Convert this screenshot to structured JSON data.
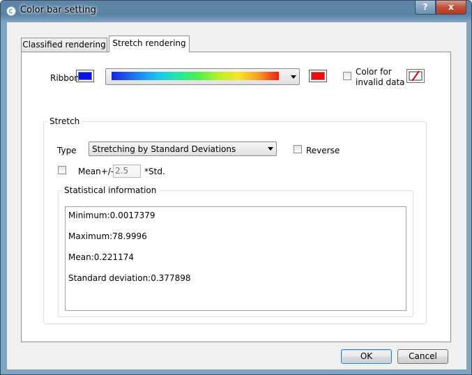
{
  "window": {
    "title": "Color bar setting",
    "help_label": "?",
    "close_label": "x"
  },
  "tabs": [
    {
      "label": "Classified rendering",
      "active": false
    },
    {
      "label": "Stretch rendering",
      "active": true
    }
  ],
  "ribbon": {
    "label": "Ribbon",
    "start_color": "#0a14e6",
    "end_color": "#ee0c0c",
    "invalid_label_line1": "Color for",
    "invalid_label_line2": "invalid data",
    "invalid_checked": false
  },
  "stretch": {
    "group_title": "Stretch",
    "type_label": "Type",
    "type_value": "Stretching by Standard Deviations",
    "reverse_label": "Reverse",
    "reverse_checked": false,
    "mean_label": "Mean+/-",
    "mean_checked": false,
    "std_value": "2.5",
    "std_suffix": "*Std."
  },
  "statistics": {
    "group_title": "Statistical information",
    "lines": [
      "Minimum:0.0017379",
      "Maximum:78.9996",
      "Mean:0.221174",
      "Standard deviation:0.377898"
    ]
  },
  "buttons": {
    "ok": "OK",
    "cancel": "Cancel"
  }
}
